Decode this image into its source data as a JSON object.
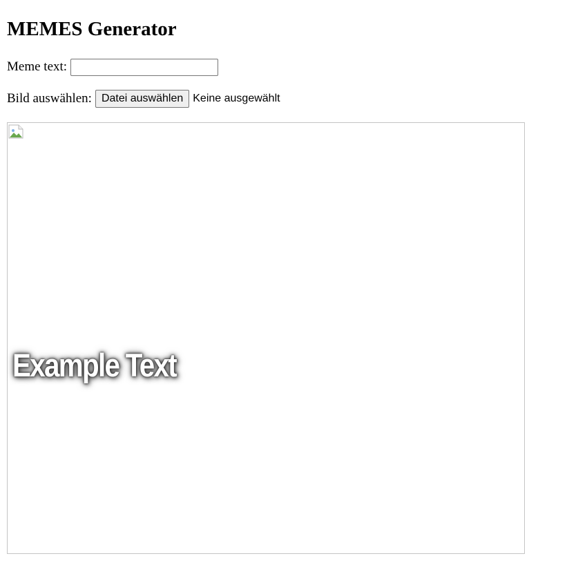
{
  "page": {
    "title": "MEMES Generator"
  },
  "form": {
    "meme_text_label": "Meme text:",
    "meme_text_value": "",
    "image_label": "Bild auswählen:",
    "file_button_label": "Datei auswählen",
    "file_status": "Keine ausgewählt"
  },
  "preview": {
    "caption": "Example Text",
    "image_icon": "broken-image-icon"
  },
  "colors": {
    "caption_text": "#ffffff",
    "frame_border": "#c4c4c4",
    "button_background": "#efefef"
  }
}
